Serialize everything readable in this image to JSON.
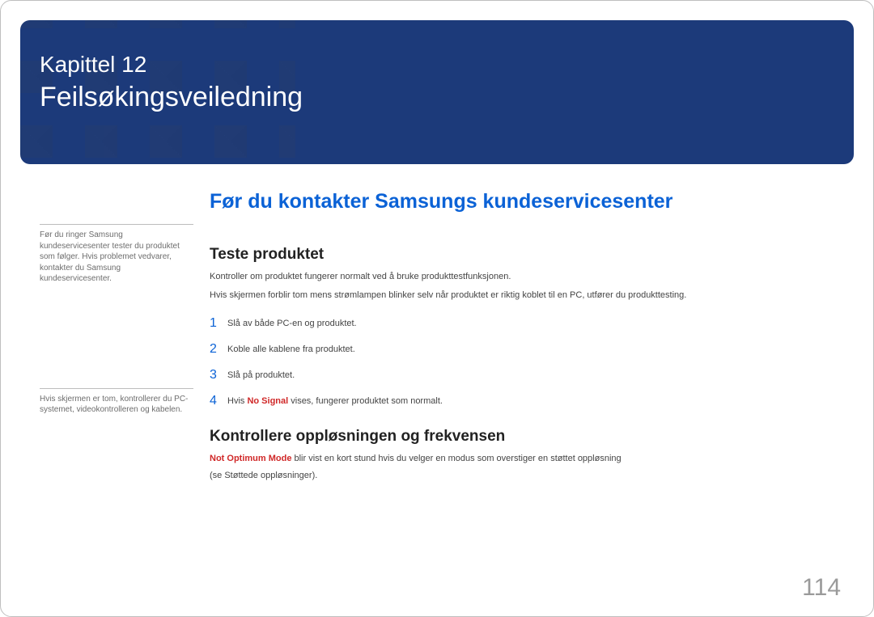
{
  "banner": {
    "chapter_label": "Kapittel 12",
    "chapter_title": "Feilsøkingsveiledning"
  },
  "sidebar": {
    "note1": "Før du ringer Samsung kundeservicesenter tester du produktet som følger. Hvis problemet vedvarer, kontakter du Samsung kundeservicesenter.",
    "note2": "Hvis skjermen er tom, kontrollerer du PC-systemet, videokontrolleren og kabelen."
  },
  "main": {
    "h1": "Før du kontakter Samsungs kundeservicesenter",
    "section1": {
      "heading": "Teste produktet",
      "p1": "Kontroller om produktet fungerer normalt ved å bruke produkttestfunksjonen.",
      "p2": "Hvis skjermen forblir tom mens strømlampen blinker selv når produktet er riktig koblet til en PC, utfører du produkttesting.",
      "steps": [
        {
          "num": "1",
          "text": "Slå av både PC-en og produktet."
        },
        {
          "num": "2",
          "text": "Koble alle kablene fra produktet."
        },
        {
          "num": "3",
          "text": "Slå på produktet."
        },
        {
          "num": "4",
          "prefix": "Hvis ",
          "highlight": "No Signal",
          "suffix": " vises, fungerer produktet som normalt."
        }
      ]
    },
    "section2": {
      "heading": "Kontrollere oppløsningen og frekvensen",
      "p1_highlight": "Not Optimum Mode",
      "p1_rest": " blir vist en kort stund hvis du velger en modus som overstiger en støttet oppløsning",
      "p2": "(se Støttede oppløsninger)."
    }
  },
  "page_number": "114"
}
